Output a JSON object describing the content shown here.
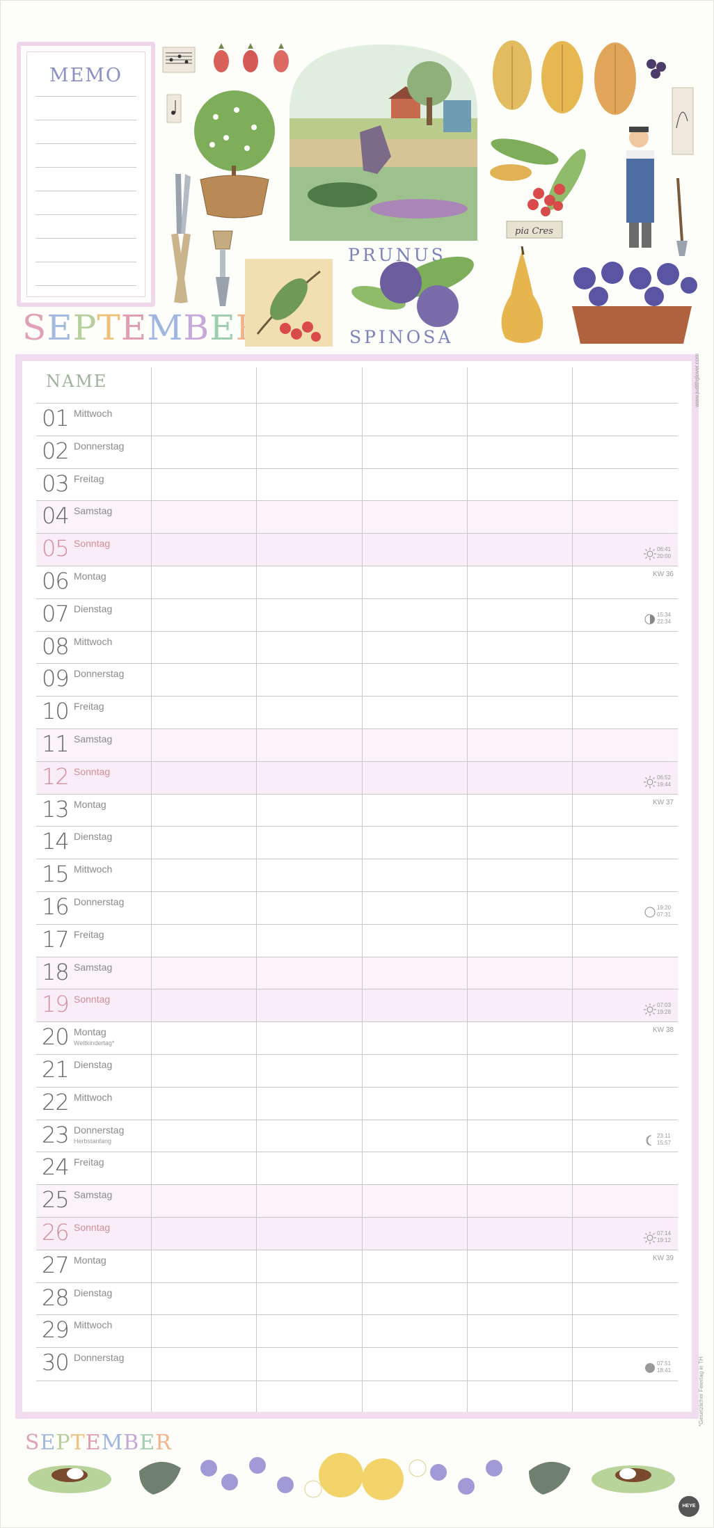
{
  "memo": {
    "title": "MEMO"
  },
  "month": {
    "title": "SEPTEMBER",
    "letter_colors": [
      "#e0a0b8",
      "#a3b9e0",
      "#b6cf9c",
      "#f0c07a",
      "#e19db2",
      "#9fb6e3",
      "#c4a9da",
      "#9fcdb0",
      "#f0b38a"
    ]
  },
  "illustration_text": {
    "prunus_top": "PRUNUS",
    "prunus_bottom": "SPINOSA",
    "label_tag": "pia Cres"
  },
  "calendar": {
    "name_header": "NAME",
    "rows": [
      {
        "num": "01",
        "day": "Mittwoch"
      },
      {
        "num": "02",
        "day": "Donnerstag"
      },
      {
        "num": "03",
        "day": "Freitag"
      },
      {
        "num": "04",
        "day": "Samstag"
      },
      {
        "num": "05",
        "day": "Sonntag",
        "times": [
          "06:41",
          "20:00"
        ],
        "symbol": "sun"
      },
      {
        "num": "06",
        "day": "Montag",
        "kw": "KW 36"
      },
      {
        "num": "07",
        "day": "Dienstag",
        "times": [
          "15:34",
          "22:34"
        ],
        "symbol": "half-moon"
      },
      {
        "num": "08",
        "day": "Mittwoch"
      },
      {
        "num": "09",
        "day": "Donnerstag"
      },
      {
        "num": "10",
        "day": "Freitag"
      },
      {
        "num": "11",
        "day": "Samstag"
      },
      {
        "num": "12",
        "day": "Sonntag",
        "times": [
          "06:52",
          "19:44"
        ],
        "symbol": "sun"
      },
      {
        "num": "13",
        "day": "Montag",
        "kw": "KW 37"
      },
      {
        "num": "14",
        "day": "Dienstag"
      },
      {
        "num": "15",
        "day": "Mittwoch"
      },
      {
        "num": "16",
        "day": "Donnerstag",
        "times": [
          "19:20",
          "07:31"
        ],
        "symbol": "full-moon"
      },
      {
        "num": "17",
        "day": "Freitag"
      },
      {
        "num": "18",
        "day": "Samstag"
      },
      {
        "num": "19",
        "day": "Sonntag",
        "times": [
          "07:03",
          "19:28"
        ],
        "symbol": "sun"
      },
      {
        "num": "20",
        "day": "Montag",
        "sub": "Weltkindertag*",
        "kw": "KW 38"
      },
      {
        "num": "21",
        "day": "Dienstag"
      },
      {
        "num": "22",
        "day": "Mittwoch"
      },
      {
        "num": "23",
        "day": "Donnerstag",
        "sub": "Herbstanfang",
        "times": [
          "23:11",
          "15:57"
        ],
        "symbol": "crescent"
      },
      {
        "num": "24",
        "day": "Freitag"
      },
      {
        "num": "25",
        "day": "Samstag"
      },
      {
        "num": "26",
        "day": "Sonntag",
        "times": [
          "07:14",
          "19:12"
        ],
        "symbol": "sun"
      },
      {
        "num": "27",
        "day": "Montag",
        "kw": "KW 39"
      },
      {
        "num": "28",
        "day": "Dienstag"
      },
      {
        "num": "29",
        "day": "Mittwoch"
      },
      {
        "num": "30",
        "day": "Donnerstag",
        "times": [
          "07:51",
          "18:41"
        ],
        "symbol": "new-moon"
      }
    ]
  },
  "side": {
    "url": "www.judithglover.com",
    "note": "*Gesetzlicher Feiertag in TH"
  },
  "footer": {
    "title": "SEPTEMBER",
    "logo": "HEYE"
  },
  "colors": {
    "pink_border": "#f2dcef",
    "sunday": "#d48c99",
    "saturday_bg": "#fbf3fa",
    "sunday_bg": "#f9edf7"
  }
}
